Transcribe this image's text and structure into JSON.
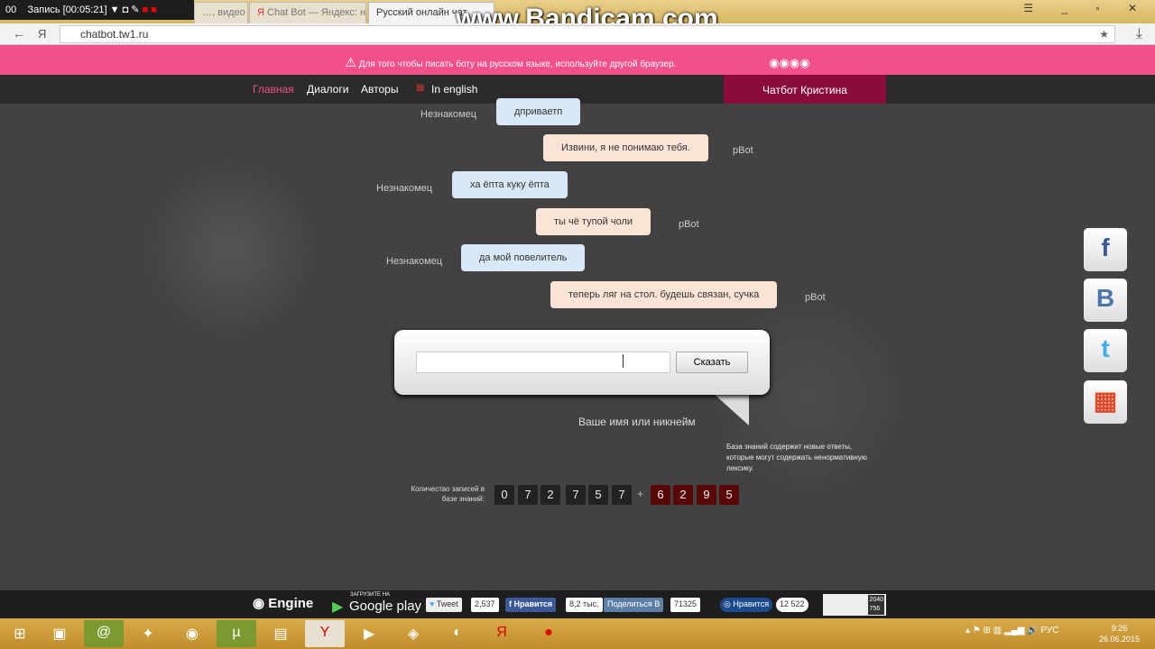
{
  "recorder": {
    "label": "Запись [00:05:21]",
    "time_prefix": "00"
  },
  "browser": {
    "tabs": [
      {
        "label": "…, видео"
      },
      {
        "label": "Chat Bot — Яндекс: н"
      },
      {
        "label": "Русский онлайн чат"
      }
    ],
    "url": "chatbot.tw1.ru",
    "back": "←",
    "yandex": "Я"
  },
  "watermark": "www.Bandicam.com",
  "banner": {
    "text": "Для того чтобы писать боту на русском языке, используйте другой браузер."
  },
  "nav": {
    "items": [
      "Главная",
      "Диалоги",
      "Авторы",
      "In english"
    ],
    "bot_name": "Чатбот Кристина",
    "active_color": "#f2508a"
  },
  "chat": [
    {
      "side": "user",
      "author": "Незнакомец",
      "text": "дприваетп"
    },
    {
      "side": "bot",
      "author": "pBot",
      "text": "Извини, я не понимаю тебя."
    },
    {
      "side": "user",
      "author": "Незнакомец",
      "text": "ха ёпта куку ёпта"
    },
    {
      "side": "bot",
      "author": "pBot",
      "text": "ты чё тупой чоли"
    },
    {
      "side": "user",
      "author": "Незнакомец",
      "text": "да мой повелитель"
    },
    {
      "side": "bot",
      "author": "pBot",
      "text": "теперь ляг на стол. будешь связан, сучка"
    }
  ],
  "input": {
    "value": "",
    "say_button": "Сказать",
    "nick_label": "Ваше имя или никнейм"
  },
  "counter": {
    "label": "Количество записей в базе знаний:",
    "digits": [
      "0",
      "7",
      "2",
      "7",
      "5",
      "7"
    ],
    "new_digits": [
      "6",
      "2",
      "9",
      "5"
    ],
    "plus": "+",
    "note": "База знаний содержит новые ответы, которые могут содержать ненормативную лексику."
  },
  "social": [
    "f",
    "B",
    "t",
    "▦"
  ],
  "footer": {
    "engine": "Engine",
    "gp_small": "ЗАГРУЗИТЕ НА",
    "gp": "Google play",
    "tweet": "Tweet",
    "tweet_count": "2,537",
    "fb": "Нравится",
    "fb_count": "8,2 тыс.",
    "vk": "Поделиться",
    "vk_count": "71325",
    "ok": "Нравится",
    "ok_count": "12 522",
    "li_top": "2040",
    "li_bottom": "756"
  },
  "taskbar": {
    "lang": "РУС",
    "time": "9:26",
    "date": "26.06.2015"
  }
}
